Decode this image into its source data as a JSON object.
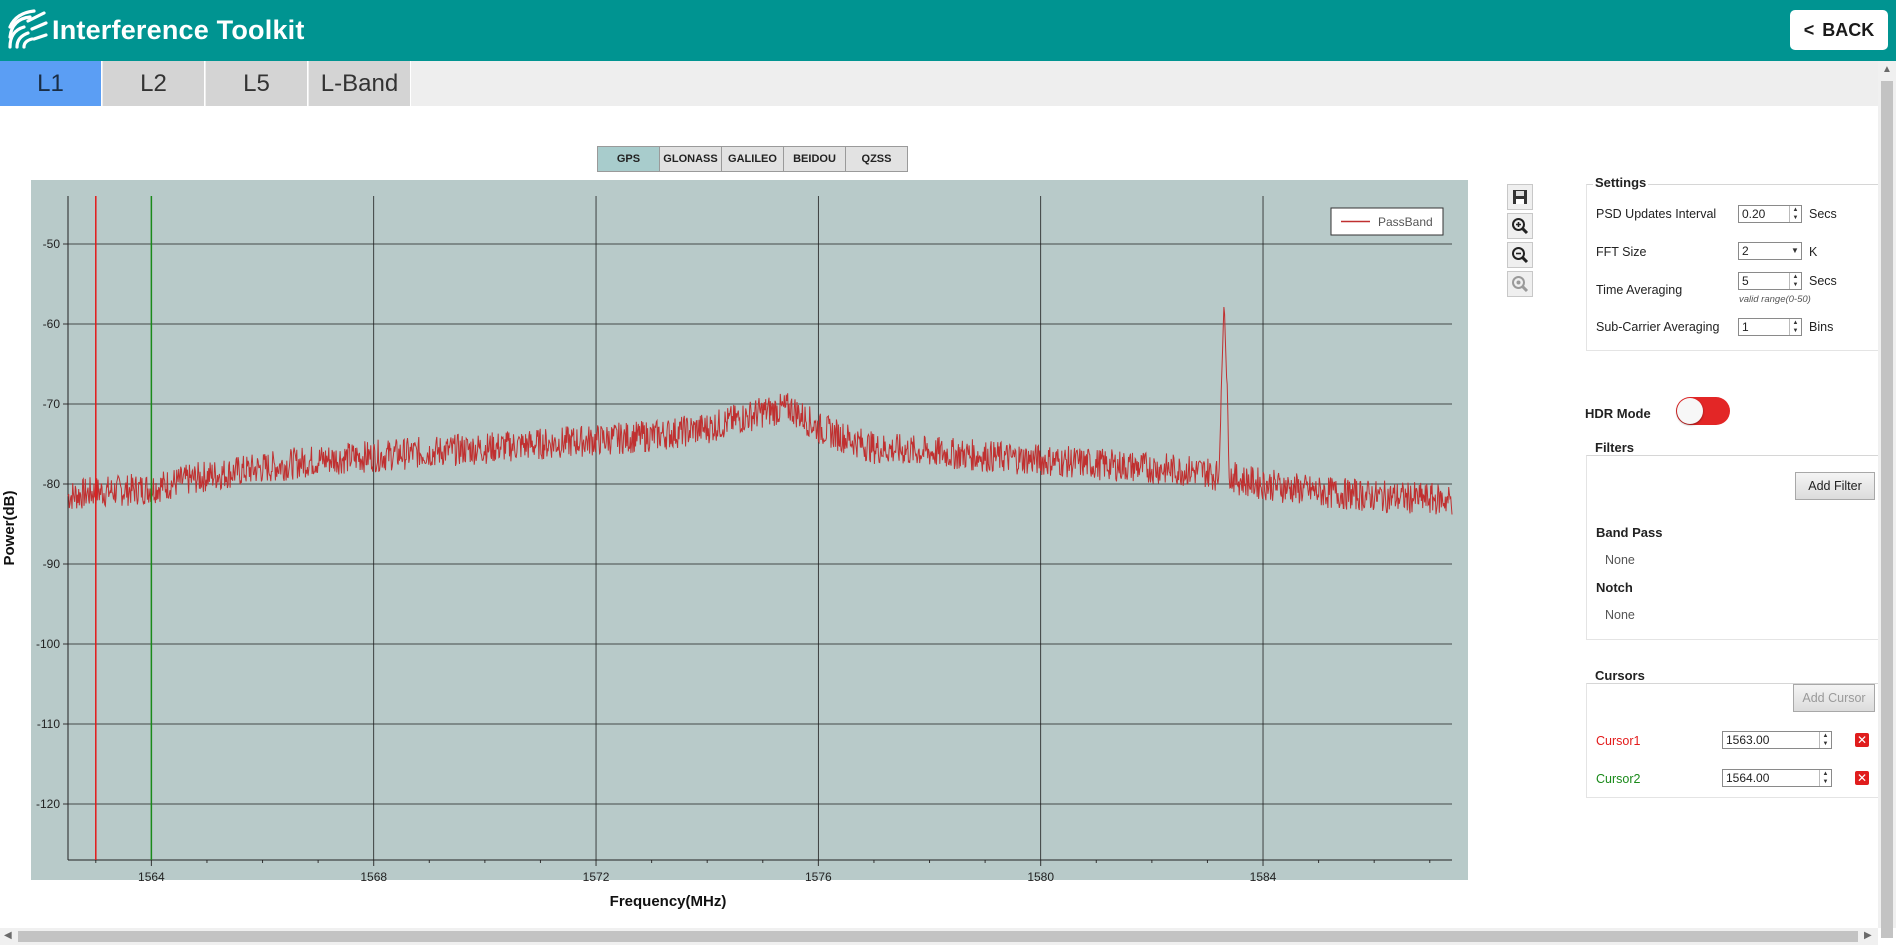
{
  "app": {
    "title": "Interference Toolkit",
    "back_label": "BACK",
    "back_chevron": "<"
  },
  "bands": [
    "L1",
    "L2",
    "L5",
    "L-Band"
  ],
  "active_band": "L1",
  "constellations": [
    "GPS",
    "GLONASS",
    "GALILEO",
    "BEIDOU",
    "QZSS"
  ],
  "active_constellation": "GPS",
  "settings": {
    "title": "Settings",
    "psd_label": "PSD Updates Interval",
    "psd_value": "0.20",
    "psd_unit": "Secs",
    "fft_label": "FFT Size",
    "fft_value": "2",
    "fft_unit": "K",
    "time_avg_label": "Time Averaging",
    "time_avg_value": "5",
    "time_avg_unit": "Secs",
    "time_avg_hint": "valid range(0-50)",
    "subcarrier_label": "Sub-Carrier Averaging",
    "subcarrier_value": "1",
    "subcarrier_unit": "Bins"
  },
  "hdr": {
    "label": "HDR Mode",
    "on": true
  },
  "filters": {
    "title": "Filters",
    "add_label": "Add Filter",
    "bandpass_label": "Band Pass",
    "bandpass_value": "None",
    "notch_label": "Notch",
    "notch_value": "None"
  },
  "cursors": {
    "title": "Cursors",
    "add_label": "Add Cursor",
    "items": [
      {
        "name": "Cursor1",
        "value": "1563.00",
        "color": "#e31a1a"
      },
      {
        "name": "Cursor2",
        "value": "1564.00",
        "color": "#1a8a1a"
      }
    ]
  },
  "tools": [
    "save-icon",
    "zoom-in-icon",
    "zoom-out-icon",
    "zoom-reset-icon"
  ],
  "chart_data": {
    "type": "line",
    "title": "",
    "xlabel": "Frequency(MHz)",
    "ylabel": "Power(dB)",
    "xlim": [
      1562.5,
      1587.4
    ],
    "ylim": [
      -127,
      -44
    ],
    "x_ticks": [
      1564,
      1568,
      1572,
      1576,
      1580,
      1584
    ],
    "y_ticks": [
      -50,
      -60,
      -70,
      -80,
      -90,
      -100,
      -110,
      -120
    ],
    "grid": true,
    "background": "#b8cac9",
    "legend": {
      "position": "top-right",
      "entries": [
        "PassBand"
      ]
    },
    "cursor_lines": [
      {
        "name": "Cursor1",
        "x": 1563.0,
        "color": "#e31a1a"
      },
      {
        "name": "Cursor2",
        "x": 1564.0,
        "color": "#1a8a1a"
      }
    ],
    "series": [
      {
        "name": "PassBand",
        "color": "#c03030",
        "x": [
          1562.5,
          1563,
          1563.5,
          1564,
          1565,
          1566,
          1567,
          1568,
          1569,
          1570,
          1571,
          1572,
          1573,
          1574,
          1575,
          1575.5,
          1576,
          1577,
          1578,
          1579,
          1580,
          1581,
          1582,
          1583,
          1583.2,
          1583.3,
          1583.4,
          1583.6,
          1584,
          1585,
          1586,
          1587.4
        ],
        "values": [
          -81.5,
          -81,
          -80.8,
          -80.5,
          -79,
          -78,
          -77,
          -76.5,
          -76,
          -75.5,
          -75,
          -74.5,
          -74,
          -73,
          -71,
          -70.5,
          -73,
          -75.5,
          -76,
          -76.5,
          -77,
          -77.5,
          -78,
          -78.5,
          -79,
          -57,
          -79,
          -79.5,
          -80,
          -81,
          -81.5,
          -82
        ]
      }
    ]
  }
}
